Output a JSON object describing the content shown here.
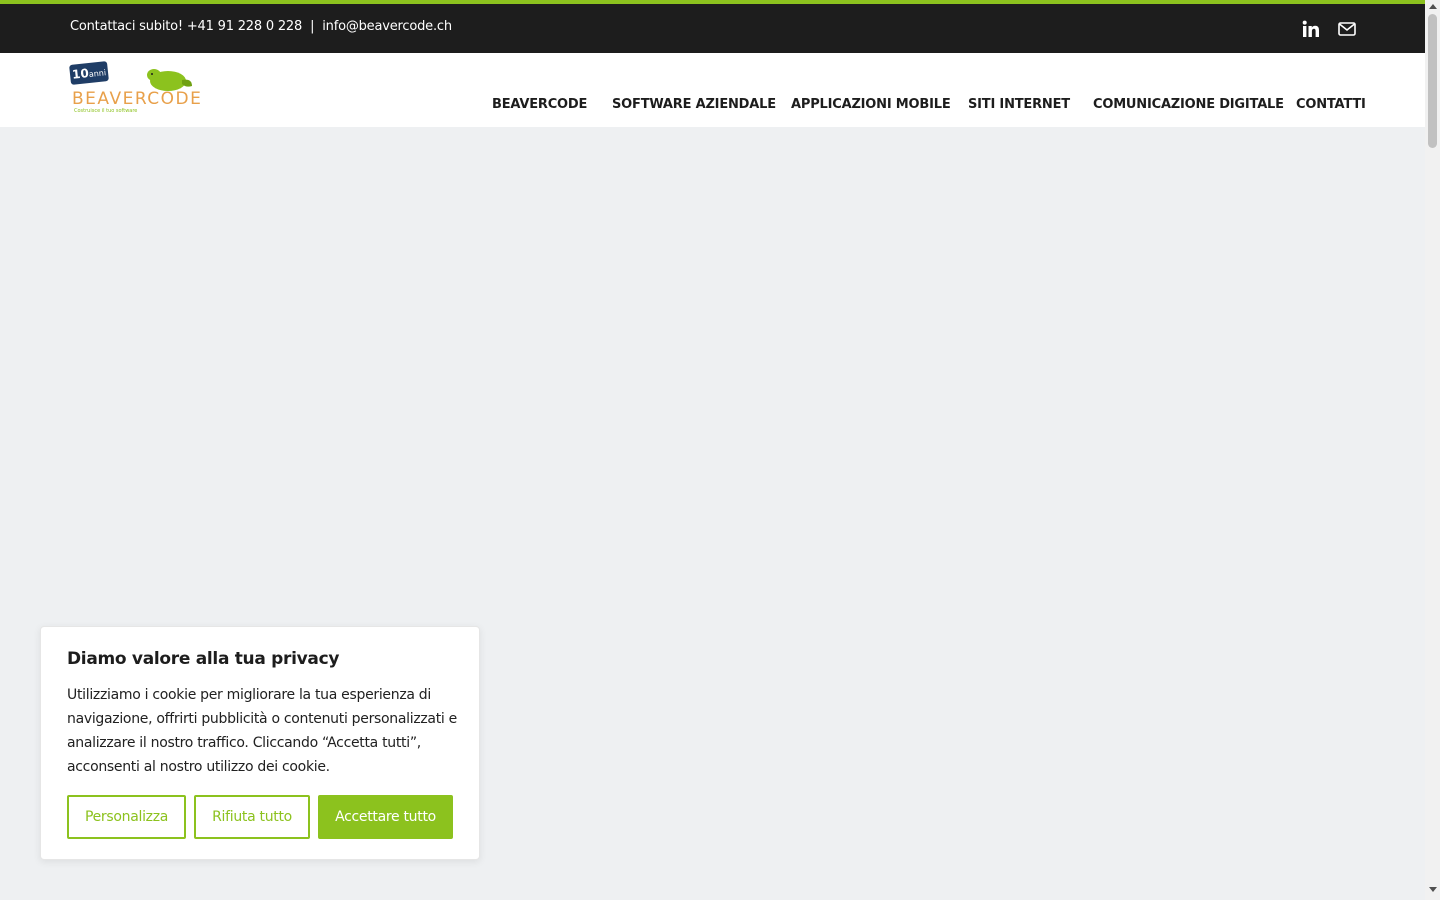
{
  "topbar": {
    "contact_label": "Contattaci subito! +41 91 228 0 228",
    "separator": "|",
    "email": "info@beavercode.ch",
    "social": [
      "linkedin-icon",
      "mail-icon"
    ]
  },
  "logo": {
    "badge_number": "10",
    "badge_word": "anni",
    "brand": "BEAVERCODE",
    "tagline": "Costruisce il tuo software"
  },
  "nav": {
    "items": [
      {
        "label": "BEAVERCODE"
      },
      {
        "label": "SOFTWARE AZIENDALE"
      },
      {
        "label": "APPLICAZIONI MOBILE"
      },
      {
        "label": "SITI INTERNET"
      },
      {
        "label": "COMUNICAZIONE DIGITALE"
      },
      {
        "label": "CONTATTI"
      }
    ]
  },
  "cookie": {
    "title": "Diamo valore alla tua privacy",
    "body": "Utilizziamo i cookie per migliorare la tua esperienza di navigazione, offrirti pubblicità o contenuti personalizzati e analizzare il nostro traffico. Cliccando “Accetta tutti”, acconsenti al nostro utilizzo dei cookie.",
    "customize_label": "Personalizza",
    "reject_label": "Rifiuta tutto",
    "accept_label": "Accettare tutto"
  },
  "colors": {
    "accent": "#8cc21e",
    "topbar_bg": "#1d1d1d",
    "page_bg": "#eef0f2"
  }
}
